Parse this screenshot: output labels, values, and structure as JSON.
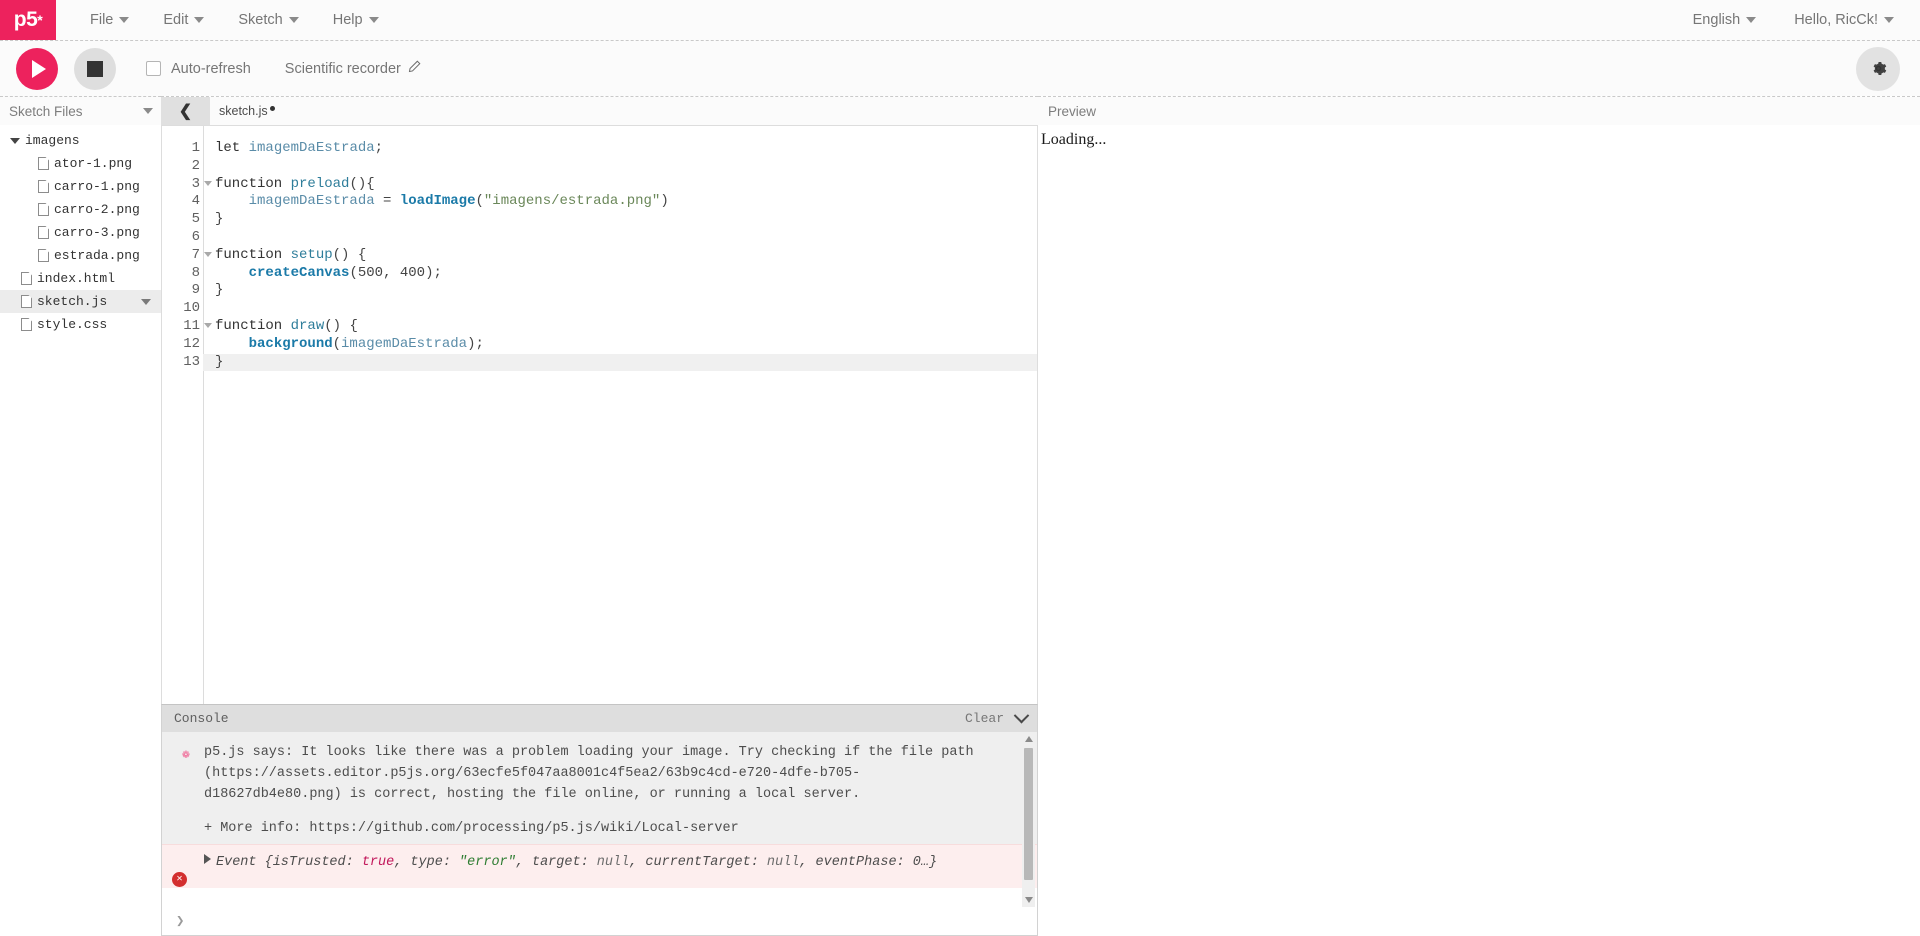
{
  "navbar": {
    "logo_text": "p5",
    "logo_star": "*",
    "menus": [
      {
        "label": "File"
      },
      {
        "label": "Edit"
      },
      {
        "label": "Sketch"
      },
      {
        "label": "Help"
      }
    ],
    "language": "English",
    "greeting": "Hello, RicCk!"
  },
  "toolbar": {
    "play_title": "play-sketch",
    "stop_title": "stop-sketch",
    "autorefresh_label": "Auto-refresh",
    "autorefresh_checked": false,
    "sketch_name": "Scientific recorder",
    "pencil_glyph": "✎",
    "gear_glyph": "✱"
  },
  "sidebar": {
    "title": "Sketch Files",
    "files": [
      {
        "name": "imagens",
        "type": "folder",
        "depth": 0,
        "open": true,
        "selected": false
      },
      {
        "name": "ator-1.png",
        "type": "file",
        "depth": 2,
        "selected": false
      },
      {
        "name": "carro-1.png",
        "type": "file",
        "depth": 2,
        "selected": false
      },
      {
        "name": "carro-2.png",
        "type": "file",
        "depth": 2,
        "selected": false
      },
      {
        "name": "carro-3.png",
        "type": "file",
        "depth": 2,
        "selected": false
      },
      {
        "name": "estrada.png",
        "type": "file",
        "depth": 2,
        "selected": false
      },
      {
        "name": "index.html",
        "type": "file",
        "depth": 1,
        "selected": false
      },
      {
        "name": "sketch.js",
        "type": "file",
        "depth": 1,
        "selected": true
      },
      {
        "name": "style.css",
        "type": "file",
        "depth": 1,
        "selected": false
      }
    ]
  },
  "editor": {
    "collapse_glyph": "❮",
    "tab_name": "sketch.js",
    "unsaved": true,
    "active_line": 13,
    "lines": [
      {
        "n": 1,
        "fold": false,
        "tokens": [
          {
            "t": "kw",
            "v": "let"
          },
          {
            "t": "pl",
            "v": " "
          },
          {
            "t": "var",
            "v": "imagemDaEstrada"
          },
          {
            "t": "pl",
            "v": ";"
          }
        ]
      },
      {
        "n": 2,
        "fold": false,
        "tokens": []
      },
      {
        "n": 3,
        "fold": true,
        "tokens": [
          {
            "t": "kw",
            "v": "function"
          },
          {
            "t": "pl",
            "v": " "
          },
          {
            "t": "fn",
            "v": "preload"
          },
          {
            "t": "pl",
            "v": "(){"
          }
        ]
      },
      {
        "n": 4,
        "fold": false,
        "tokens": [
          {
            "t": "pl",
            "v": "    "
          },
          {
            "t": "var",
            "v": "imagemDaEstrada"
          },
          {
            "t": "pl",
            "v": " = "
          },
          {
            "t": "bfn",
            "v": "loadImage"
          },
          {
            "t": "pl",
            "v": "("
          },
          {
            "t": "str",
            "v": "\"imagens/estrada.png\""
          },
          {
            "t": "pl",
            "v": ")"
          }
        ]
      },
      {
        "n": 5,
        "fold": false,
        "tokens": [
          {
            "t": "pl",
            "v": "}"
          }
        ]
      },
      {
        "n": 6,
        "fold": false,
        "tokens": []
      },
      {
        "n": 7,
        "fold": true,
        "tokens": [
          {
            "t": "kw",
            "v": "function"
          },
          {
            "t": "pl",
            "v": " "
          },
          {
            "t": "fn",
            "v": "setup"
          },
          {
            "t": "pl",
            "v": "() {"
          }
        ]
      },
      {
        "n": 8,
        "fold": false,
        "tokens": [
          {
            "t": "pl",
            "v": "    "
          },
          {
            "t": "bfn",
            "v": "createCanvas"
          },
          {
            "t": "pl",
            "v": "("
          },
          {
            "t": "num",
            "v": "500"
          },
          {
            "t": "pl",
            "v": ", "
          },
          {
            "t": "num",
            "v": "400"
          },
          {
            "t": "pl",
            "v": ");"
          }
        ]
      },
      {
        "n": 9,
        "fold": false,
        "tokens": [
          {
            "t": "pl",
            "v": "}"
          }
        ]
      },
      {
        "n": 10,
        "fold": false,
        "tokens": []
      },
      {
        "n": 11,
        "fold": true,
        "tokens": [
          {
            "t": "kw",
            "v": "function"
          },
          {
            "t": "pl",
            "v": " "
          },
          {
            "t": "fn",
            "v": "draw"
          },
          {
            "t": "pl",
            "v": "() {"
          }
        ]
      },
      {
        "n": 12,
        "fold": false,
        "tokens": [
          {
            "t": "pl",
            "v": "    "
          },
          {
            "t": "bfn",
            "v": "background"
          },
          {
            "t": "pl",
            "v": "("
          },
          {
            "t": "var",
            "v": "imagemDaEstrada"
          },
          {
            "t": "pl",
            "v": ");"
          }
        ]
      },
      {
        "n": 13,
        "fold": false,
        "tokens": [
          {
            "t": "pl",
            "v": "}"
          }
        ]
      }
    ]
  },
  "console": {
    "title": "Console",
    "clear_label": "Clear",
    "flower_glyph": "❁",
    "message": "p5.js says: It looks like there was a problem loading your image. Try checking if the file path (https://assets.editor.p5js.org/63ecfe5f047aa8001c4f5ea2/63b9c4cd-e720-4dfe-b705-d18627db4e80.png) is correct, hosting the file online, or running a local server.",
    "more_info": "+ More info: https://github.com/processing/p5.js/wiki/Local-server",
    "error": {
      "badge_glyph": "✕",
      "prefix": "Event {isTrusted: ",
      "v1": "true",
      "mid1": ", type: ",
      "v2": "\"error\"",
      "mid2": ", target: ",
      "v3": "null",
      "mid3": ", currentTarget: ",
      "v4": "null",
      "suffix": ", eventPhase: 0…}"
    },
    "prompt_glyph": "❯"
  },
  "preview": {
    "title": "Preview",
    "status": "Loading..."
  },
  "colors": {
    "brand": "#ed225d",
    "error": "#d32f2f",
    "error_bg": "#fdeeee",
    "console_bg": "#efefef"
  }
}
